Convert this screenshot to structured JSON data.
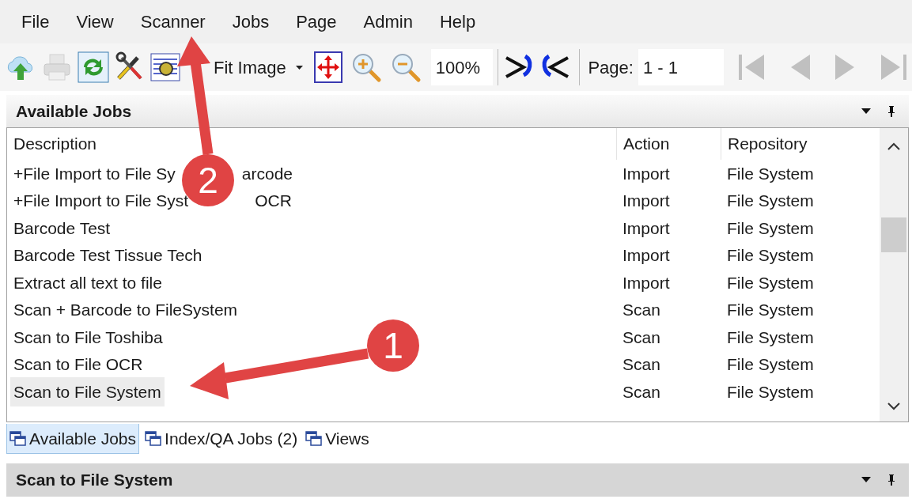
{
  "menu": [
    "File",
    "View",
    "Scanner",
    "Jobs",
    "Page",
    "Admin",
    "Help"
  ],
  "toolbar": {
    "left_buttons": [
      {
        "kind": "upload",
        "disabled": false
      },
      {
        "kind": "print",
        "disabled": true
      },
      {
        "kind": "refresh",
        "disabled": false
      },
      {
        "kind": "tools",
        "disabled": false
      },
      {
        "kind": "scanner",
        "disabled": false
      }
    ],
    "zoom_mode": "Fit Image",
    "zoom": "100%",
    "page_label": "Page:",
    "page_value": "1 - 1",
    "nav_buttons": [
      {
        "kind": "first",
        "disabled": true
      },
      {
        "kind": "previous",
        "disabled": true
      },
      {
        "kind": "next",
        "disabled": true
      },
      {
        "kind": "last",
        "disabled": true
      }
    ]
  },
  "jobs_panel": {
    "title": "Available Jobs",
    "columns": [
      "Description",
      "Action",
      "Repository"
    ],
    "rows": [
      {
        "description": "+File Import to File Sy",
        "description_after": "arcode",
        "action": "Import",
        "repository": "File System",
        "selected": false
      },
      {
        "description": "+File Import to File Syst",
        "description_after": "OCR",
        "action": "Import",
        "repository": "File System",
        "selected": false
      },
      {
        "description": "Barcode Test",
        "action": "Import",
        "repository": "File System",
        "selected": false
      },
      {
        "description": "Barcode Test Tissue Tech",
        "action": "Import",
        "repository": "File System",
        "selected": false
      },
      {
        "description": "Extract all text to file",
        "action": "Import",
        "repository": "File System",
        "selected": false
      },
      {
        "description": "Scan + Barcode to FileSystem",
        "action": "Scan",
        "repository": "File System",
        "selected": false
      },
      {
        "description": "Scan to File Toshiba",
        "action": "Scan",
        "repository": "File System",
        "selected": false
      },
      {
        "description": "Scan to File OCR",
        "action": "Scan",
        "repository": "File System",
        "selected": false
      },
      {
        "description": "Scan to File System",
        "action": "Scan",
        "repository": "File System",
        "selected": true
      }
    ]
  },
  "tabs": [
    {
      "label": "Available Jobs",
      "selected": true
    },
    {
      "label": "Index/QA Jobs (2)",
      "selected": false
    },
    {
      "label": "Views",
      "selected": false
    }
  ],
  "detail_panel": {
    "title": "Scan to File System"
  },
  "annotations": [
    {
      "number": "2"
    },
    {
      "number": "1"
    }
  ]
}
